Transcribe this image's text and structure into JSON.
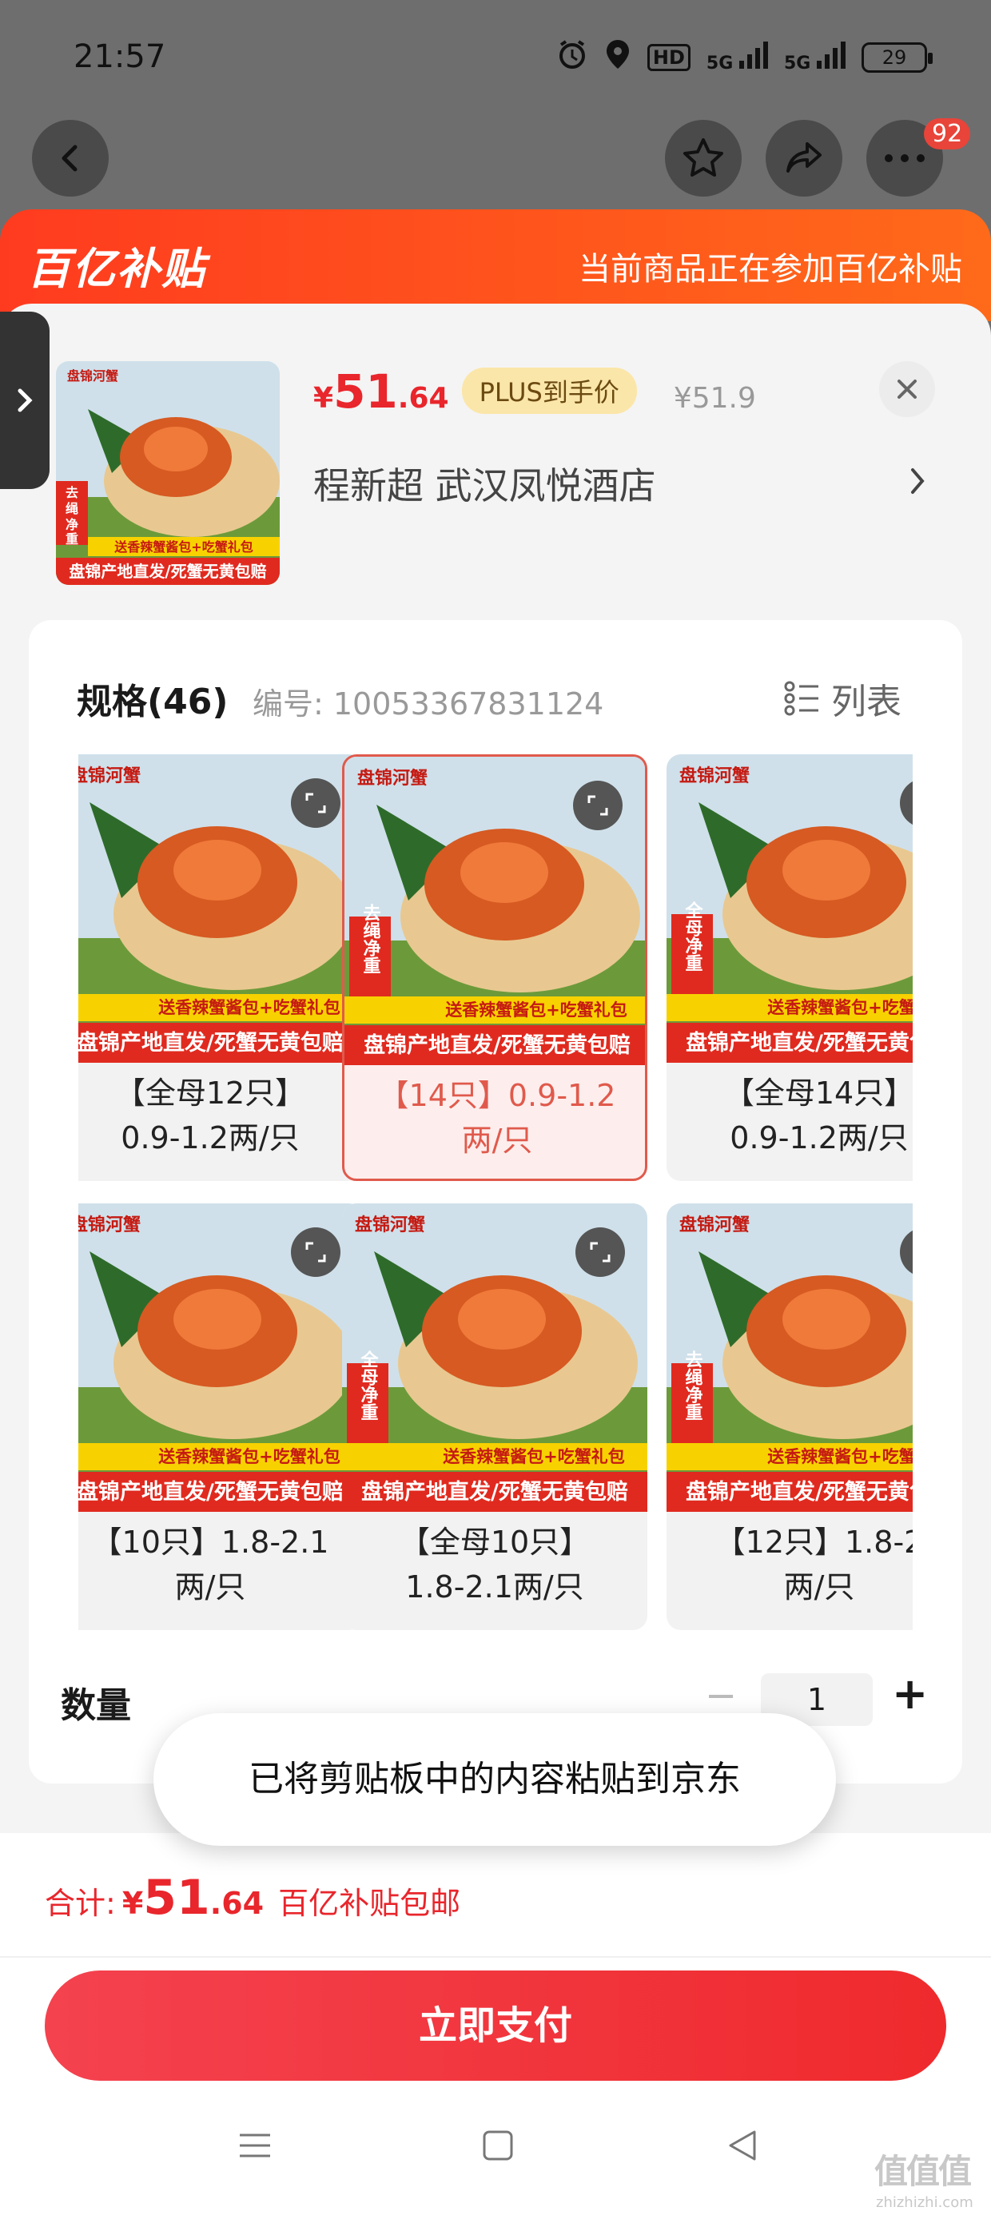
{
  "status_bar": {
    "time": "21:57",
    "hd_label": "HD",
    "signal1": "5G",
    "signal2": "5G",
    "battery": "29"
  },
  "top_nav": {
    "notification_count": "92",
    "icons": [
      "back-icon",
      "star-icon",
      "share-icon",
      "more-icon"
    ]
  },
  "subsidy": {
    "logo": "百亿补贴",
    "text": "当前商品正在参加百亿补贴"
  },
  "product": {
    "currency": "¥",
    "price_int": "51",
    "price_dec": ".64",
    "plus_label": "PLUS到手价",
    "original_price": "¥51.9",
    "address": "程新超  武汉凤悦酒店",
    "image_text": {
      "brand": "盘锦河蟹",
      "promo": "送香辣蟹酱包+吃蟹礼包",
      "slogan": "盘锦产地直发/死蟹无黄包赔",
      "tag_rope": "去绳净重",
      "tag_female": "全母净重"
    }
  },
  "spec": {
    "title": "规格(46)",
    "code": "编号: 10053367831124",
    "list_label": "列表",
    "items": [
      {
        "label": "【全母12只】0.9-1.2两/只",
        "selected": false
      },
      {
        "label": "【14只】0.9-1.2两/只",
        "selected": true
      },
      {
        "label": "【全母14只】0.9-1.2两/只",
        "selected": false
      },
      {
        "label": "【10只】1.8-2.1两/只",
        "selected": false
      },
      {
        "label": "【全母10只】1.8-2.1两/只",
        "selected": false
      },
      {
        "label": "【12只】1.8-2两/只",
        "selected": false
      }
    ],
    "display_lines": [
      [
        "【全母12只】",
        "0.9-1.2两/只"
      ],
      [
        "【14只】0.9-1.2",
        "两/只"
      ],
      [
        "【全母14只】",
        "0.9-1.2两/只"
      ],
      [
        "【10只】1.8-2.1",
        "两/只"
      ],
      [
        "【全母10只】",
        "1.8-2.1两/只"
      ],
      [
        "【12只】1.8-2",
        "两/只"
      ]
    ]
  },
  "quantity": {
    "label": "数量",
    "minus": "−",
    "value": "1",
    "plus": "+"
  },
  "toast": {
    "text": "已将剪贴板中的内容粘贴到京东"
  },
  "footer": {
    "total_label": "合计:",
    "currency": "¥",
    "total_int": "51",
    "total_dec": ".64",
    "shipping": "百亿补贴包邮",
    "pay_button": "立即支付"
  },
  "watermark": {
    "logo": "值值值",
    "url": "zhizhizhi.com"
  },
  "colors": {
    "accent_red": "#e8262c",
    "banner_orange": "#ff5a1a",
    "selected_border": "#e05a4c",
    "plus_gold": "#fbe6a9"
  }
}
